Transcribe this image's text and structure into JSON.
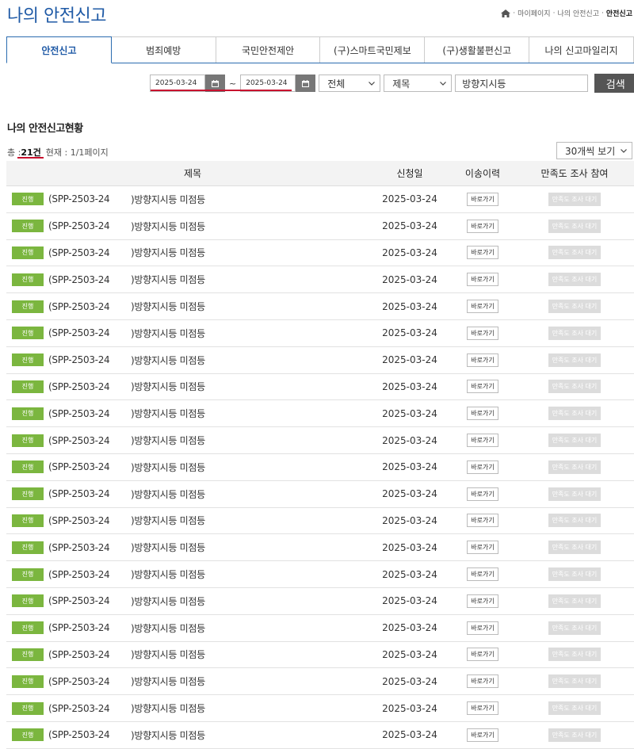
{
  "page_title": "나의 안전신고",
  "breadcrumb": {
    "items": [
      "마이페이지",
      "나의 안전신고"
    ],
    "current": "안전신고"
  },
  "tabs": [
    "안전신고",
    "범죄예방",
    "국민안전제안",
    "(구)스마트국민제보",
    "(구)생활불편신고",
    "나의 신고마일리지"
  ],
  "active_tab": 0,
  "search": {
    "start_date": "2025-03-24",
    "end_date": "2025-03-24",
    "tilde": "~",
    "category": "전체",
    "field": "제목",
    "keyword": "방향지시등",
    "button": "검색"
  },
  "section_title": "나의 안전신고현황",
  "summary": {
    "total_label": "총 :",
    "total": "21건",
    "current": "현재 : 1/1페이지"
  },
  "per_page": "30개씩 보기",
  "columns": {
    "title": "제목",
    "date": "신청일",
    "transfer": "이송이력",
    "survey": "만족도 조사 참여"
  },
  "rows": [
    {
      "status": "진행",
      "code": "(SPP-2503-24",
      "subject": ")방향지시등 미점등",
      "date": "2025-03-24",
      "transfer": "바로가기",
      "survey": "만족도 조사 대기"
    },
    {
      "status": "진행",
      "code": "(SPP-2503-24",
      "subject": ")방향지시등 미점등",
      "date": "2025-03-24",
      "transfer": "바로가기",
      "survey": "만족도 조사 대기"
    },
    {
      "status": "진행",
      "code": "(SPP-2503-24",
      "subject": ")방향지시등 미점등",
      "date": "2025-03-24",
      "transfer": "바로가기",
      "survey": "만족도 조사 대기"
    },
    {
      "status": "진행",
      "code": "(SPP-2503-24",
      "subject": ")방향지시등 미점등",
      "date": "2025-03-24",
      "transfer": "바로가기",
      "survey": "만족도 조사 대기"
    },
    {
      "status": "진행",
      "code": "(SPP-2503-24",
      "subject": ")방향지시등 미점등",
      "date": "2025-03-24",
      "transfer": "바로가기",
      "survey": "만족도 조사 대기"
    },
    {
      "status": "진행",
      "code": "(SPP-2503-24",
      "subject": ")방향지시등 미점등",
      "date": "2025-03-24",
      "transfer": "바로가기",
      "survey": "만족도 조사 대기"
    },
    {
      "status": "진행",
      "code": "(SPP-2503-24",
      "subject": ")방향지시등 미점등",
      "date": "2025-03-24",
      "transfer": "바로가기",
      "survey": "만족도 조사 대기"
    },
    {
      "status": "진행",
      "code": "(SPP-2503-24",
      "subject": ")방향지시등 미점등",
      "date": "2025-03-24",
      "transfer": "바로가기",
      "survey": "만족도 조사 대기"
    },
    {
      "status": "진행",
      "code": "(SPP-2503-24",
      "subject": ")방향지시등 미점등",
      "date": "2025-03-24",
      "transfer": "바로가기",
      "survey": "만족도 조사 대기"
    },
    {
      "status": "진행",
      "code": "(SPP-2503-24",
      "subject": ")방향지시등 미점등",
      "date": "2025-03-24",
      "transfer": "바로가기",
      "survey": "만족도 조사 대기"
    },
    {
      "status": "진행",
      "code": "(SPP-2503-24",
      "subject": ")방향지시등 미점등",
      "date": "2025-03-24",
      "transfer": "바로가기",
      "survey": "만족도 조사 대기"
    },
    {
      "status": "진행",
      "code": "(SPP-2503-24",
      "subject": ")방향지시등 미점등",
      "date": "2025-03-24",
      "transfer": "바로가기",
      "survey": "만족도 조사 대기"
    },
    {
      "status": "진행",
      "code": "(SPP-2503-24",
      "subject": ")방향지시등 미점등",
      "date": "2025-03-24",
      "transfer": "바로가기",
      "survey": "만족도 조사 대기"
    },
    {
      "status": "진행",
      "code": "(SPP-2503-24",
      "subject": ")방향지시등 미점등",
      "date": "2025-03-24",
      "transfer": "바로가기",
      "survey": "만족도 조사 대기"
    },
    {
      "status": "진행",
      "code": "(SPP-2503-24",
      "subject": ")방향지시등 미점등",
      "date": "2025-03-24",
      "transfer": "바로가기",
      "survey": "만족도 조사 대기"
    },
    {
      "status": "진행",
      "code": "(SPP-2503-24",
      "subject": ")방향지시등 미점등",
      "date": "2025-03-24",
      "transfer": "바로가기",
      "survey": "만족도 조사 대기"
    },
    {
      "status": "진행",
      "code": "(SPP-2503-24",
      "subject": ")방향지시등 미점등",
      "date": "2025-03-24",
      "transfer": "바로가기",
      "survey": "만족도 조사 대기"
    },
    {
      "status": "진행",
      "code": "(SPP-2503-24",
      "subject": ")방향지시등 미점등",
      "date": "2025-03-24",
      "transfer": "바로가기",
      "survey": "만족도 조사 대기"
    },
    {
      "status": "진행",
      "code": "(SPP-2503-24",
      "subject": ")방향지시등 미점등",
      "date": "2025-03-24",
      "transfer": "바로가기",
      "survey": "만족도 조사 대기"
    },
    {
      "status": "진행",
      "code": "(SPP-2503-24",
      "subject": ")방향지시등 미점등",
      "date": "2025-03-24",
      "transfer": "바로가기",
      "survey": "만족도 조사 대기"
    },
    {
      "status": "진행",
      "code": "(SPP-2503-24",
      "subject": ")방향지시등 미점등",
      "date": "2025-03-24",
      "transfer": "바로가기",
      "survey": "만족도 조사 대기"
    }
  ],
  "colors": {
    "title_blue": "#1f5aa6",
    "badge_green": "#7bb63f",
    "underline_red": "#c8102e"
  }
}
